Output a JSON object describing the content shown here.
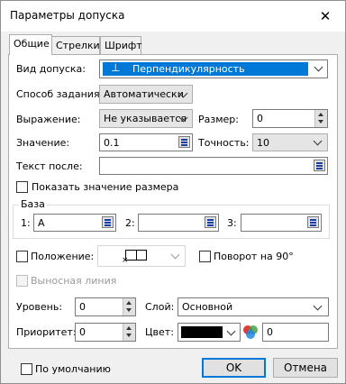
{
  "window": {
    "title": "Параметры допуска"
  },
  "tabs": [
    {
      "label": "Общие"
    },
    {
      "label": "Стрелки"
    },
    {
      "label": "Шрифт"
    }
  ],
  "tolerance": {
    "label": "Вид допуска:",
    "symbol": "⊥",
    "value": "Перпендикулярность",
    "highlight_color": "#0078d7"
  },
  "method": {
    "label": "Способ задания:",
    "value": "Автоматически"
  },
  "expression": {
    "label": "Выражение:",
    "value": "Не указывается"
  },
  "size": {
    "label": "Размер:",
    "value": "0"
  },
  "value_field": {
    "label": "Значение:",
    "value": "0.1"
  },
  "precision": {
    "label": "Точность:",
    "value": "10"
  },
  "text_after": {
    "label": "Текст после:",
    "value": ""
  },
  "show_size": {
    "label": "Показать значение размера",
    "checked": false
  },
  "base": {
    "label": "База",
    "fields": [
      {
        "label": "1:",
        "value": "A"
      },
      {
        "label": "2:",
        "value": ""
      },
      {
        "label": "3:",
        "value": ""
      }
    ]
  },
  "position": {
    "label": "Положение:",
    "checked": false
  },
  "rotate": {
    "label": "Поворот на 90°",
    "checked": false
  },
  "leader": {
    "label": "Выносная линия",
    "checked": false,
    "disabled": true
  },
  "level": {
    "label": "Уровень:",
    "value": "0"
  },
  "layer": {
    "label": "Слой:",
    "value": "Основной"
  },
  "priority": {
    "label": "Приоритет:",
    "value": "0"
  },
  "color": {
    "label": "Цвет:",
    "swatch": "#000000",
    "value": "0"
  },
  "footer": {
    "default_label": "По умолчанию",
    "ok_label": "OK",
    "cancel_label": "Отмена"
  }
}
